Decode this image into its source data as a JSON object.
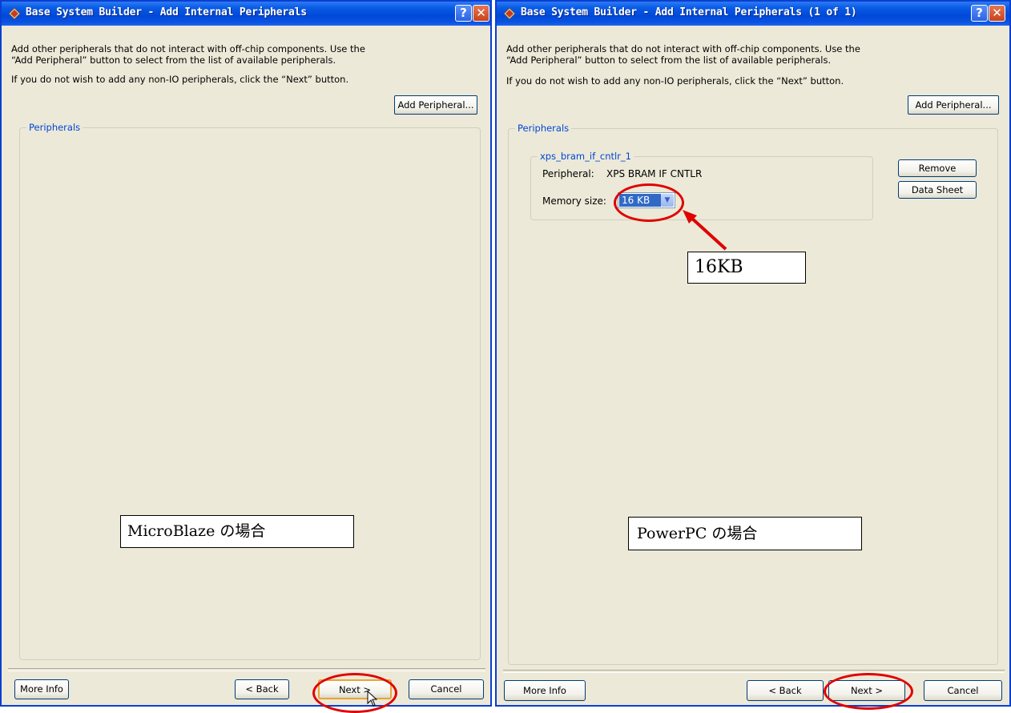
{
  "left": {
    "title": "Base System Builder - Add Internal Peripherals",
    "desc_line1": "Add other peripherals that do not interact with off-chip components.  Use the",
    "desc_line2": "“Add Peripheral” button to select from the list of available peripherals.",
    "desc_line3": "If you do not wish to add any non-IO peripherals, click the “Next” button.",
    "add_peripheral": "Add Peripheral...",
    "group_label": "Peripherals",
    "annotation": "MicroBlaze の場合",
    "more_info": "More Info",
    "back": "< Back",
    "next": "Next >",
    "cancel": "Cancel"
  },
  "right": {
    "title": "Base System Builder - Add Internal Peripherals (1 of 1)",
    "desc_line1": "Add other peripherals that do not interact with off-chip components.  Use the",
    "desc_line2": "“Add Peripheral” button to select from the list of available peripherals.",
    "desc_line3": "If you do not wish to add any non-IO peripherals, click the “Next” button.",
    "add_peripheral": "Add Peripheral...",
    "group_label": "Peripherals",
    "instance_label": "xps_bram_if_cntlr_1",
    "peripheral_label": "Peripheral:",
    "peripheral_value": "XPS BRAM IF CNTLR",
    "memory_size_label": "Memory size:",
    "memory_size_value": "16 KB",
    "remove": "Remove",
    "data_sheet": "Data Sheet",
    "callout": "16KB",
    "annotation": "PowerPC の場合",
    "more_info": "More Info",
    "back": "< Back",
    "next": "Next >",
    "cancel": "Cancel"
  },
  "colors": {
    "title_bar": "#0a5ce6",
    "dialog_bg": "#ece9d8",
    "group_label": "#0046d5",
    "highlight_ring": "#e00000",
    "selection": "#316ac5"
  }
}
